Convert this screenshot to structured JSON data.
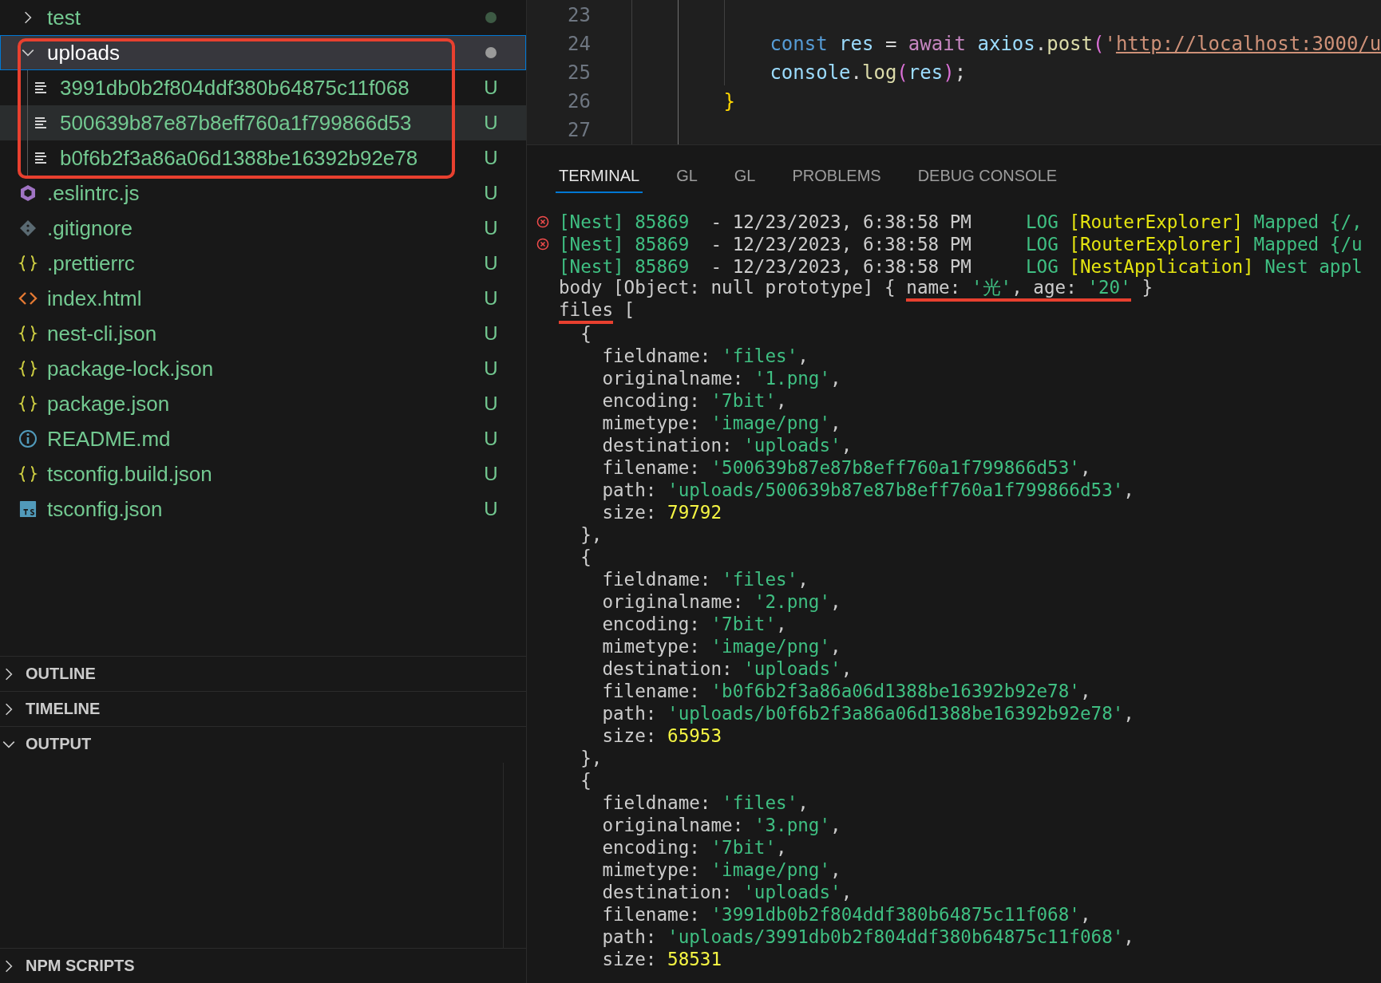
{
  "explorer": {
    "items": [
      {
        "name": "test",
        "kind": "folder",
        "expanded": false,
        "selected": false,
        "hovered": false,
        "dot": true
      },
      {
        "name": "uploads",
        "kind": "folder",
        "expanded": true,
        "selected": true,
        "hovered": false,
        "dot": true,
        "children": [
          {
            "name": "3991db0b2f804ddf380b64875c11f068",
            "kind": "text",
            "selected": false,
            "hovered": false,
            "badge": "U"
          },
          {
            "name": "500639b87e87b8eff760a1f799866d53",
            "kind": "text",
            "selected": false,
            "hovered": true,
            "badge": "U"
          },
          {
            "name": "b0f6b2f3a86a06d1388be16392b92e78",
            "kind": "text",
            "selected": false,
            "hovered": false,
            "badge": "U"
          }
        ]
      },
      {
        "name": ".eslintrc.js",
        "kind": "eslint",
        "selected": false,
        "hovered": false,
        "badge": "U"
      },
      {
        "name": ".gitignore",
        "kind": "git",
        "selected": false,
        "hovered": false,
        "badge": "U"
      },
      {
        "name": ".prettierrc",
        "kind": "braces",
        "selected": false,
        "hovered": false,
        "badge": "U"
      },
      {
        "name": "index.html",
        "kind": "code",
        "selected": false,
        "hovered": false,
        "badge": "U"
      },
      {
        "name": "nest-cli.json",
        "kind": "braces",
        "selected": false,
        "hovered": false,
        "badge": "U"
      },
      {
        "name": "package-lock.json",
        "kind": "braces",
        "selected": false,
        "hovered": false,
        "badge": "U"
      },
      {
        "name": "package.json",
        "kind": "braces",
        "selected": false,
        "hovered": false,
        "badge": "U"
      },
      {
        "name": "README.md",
        "kind": "info",
        "selected": false,
        "hovered": false,
        "badge": "U"
      },
      {
        "name": "tsconfig.build.json",
        "kind": "braces",
        "selected": false,
        "hovered": false,
        "badge": "U"
      },
      {
        "name": "tsconfig.json",
        "kind": "ts",
        "selected": false,
        "hovered": false,
        "badge": "U"
      }
    ]
  },
  "sections": [
    {
      "title": "OUTLINE",
      "expanded": false
    },
    {
      "title": "TIMELINE",
      "expanded": false
    },
    {
      "title": "OUTPUT",
      "expanded": true
    },
    {
      "title": "NPM SCRIPTS",
      "expanded": false
    }
  ],
  "editor": {
    "lines": [
      {
        "number": "23"
      },
      {
        "number": "24",
        "segments": [
          {
            "kind": "keyword",
            "text": "            const "
          },
          {
            "kind": "variable",
            "text": "res"
          },
          {
            "kind": "plain",
            "text": " = "
          },
          {
            "kind": "control",
            "text": "await "
          },
          {
            "kind": "variable",
            "text": "axios"
          },
          {
            "kind": "plain",
            "text": "."
          },
          {
            "kind": "function",
            "text": "post"
          },
          {
            "kind": "bracket",
            "text": "("
          },
          {
            "kind": "string",
            "text": "'"
          },
          {
            "kind": "link",
            "text": "http://localhost:3000/u"
          }
        ]
      },
      {
        "number": "25",
        "segments": [
          {
            "kind": "variable",
            "text": "            console"
          },
          {
            "kind": "plain",
            "text": "."
          },
          {
            "kind": "function",
            "text": "log"
          },
          {
            "kind": "bracket",
            "text": "("
          },
          {
            "kind": "variable",
            "text": "res"
          },
          {
            "kind": "bracket",
            "text": ")"
          },
          {
            "kind": "plain",
            "text": ";"
          }
        ]
      },
      {
        "number": "26",
        "segments": [
          {
            "kind": "brace",
            "text": "        }"
          }
        ]
      },
      {
        "number": "27"
      }
    ]
  },
  "panel": {
    "tabs": [
      {
        "label": "TERMINAL",
        "selected": true
      },
      {
        "label": "GL",
        "selected": false
      },
      {
        "label": "GL",
        "selected": false
      },
      {
        "label": "PROBLEMS",
        "selected": false
      },
      {
        "label": "DEBUG CONSOLE",
        "selected": false
      }
    ],
    "lines": [
      {
        "error": true,
        "segments": [
          {
            "kind": "tag",
            "text": "[Nest] 85869"
          },
          {
            "kind": "plain",
            "text": "  - 12/23/2023, 6:38:58 PM     "
          },
          {
            "kind": "tag",
            "text": "LOG "
          },
          {
            "kind": "context",
            "text": "[RouterExplorer]"
          },
          {
            "kind": "tag",
            "text": " Mapped {/,"
          }
        ]
      },
      {
        "error": true,
        "segments": [
          {
            "kind": "tag",
            "text": "[Nest] 85869"
          },
          {
            "kind": "plain",
            "text": "  - 12/23/2023, 6:38:58 PM     "
          },
          {
            "kind": "tag",
            "text": "LOG "
          },
          {
            "kind": "context",
            "text": "[RouterExplorer]"
          },
          {
            "kind": "tag",
            "text": " Mapped {/u"
          }
        ]
      },
      {
        "error": false,
        "segments": [
          {
            "kind": "tag",
            "text": "[Nest] 85869"
          },
          {
            "kind": "plain",
            "text": "  - 12/23/2023, 6:38:58 PM     "
          },
          {
            "kind": "tag",
            "text": "LOG "
          },
          {
            "kind": "context",
            "text": "[NestApplication]"
          },
          {
            "kind": "tag",
            "text": " Nest appl"
          }
        ]
      },
      {
        "error": false,
        "segments": [
          {
            "kind": "plain",
            "text": "body [Object: null prototype] { "
          },
          {
            "kind": "plain",
            "text": "name: ",
            "marked": true
          },
          {
            "kind": "string",
            "text": "'光'",
            "marked": true
          },
          {
            "kind": "plain",
            "text": ", age: ",
            "marked": true
          },
          {
            "kind": "string",
            "text": "'20'",
            "marked": true
          },
          {
            "kind": "plain",
            "text": " }"
          }
        ]
      },
      {
        "error": false,
        "segments": [
          {
            "kind": "plain",
            "text": "files",
            "marked": true
          },
          {
            "kind": "plain",
            "text": " ["
          }
        ]
      },
      {
        "error": false,
        "segments": [
          {
            "kind": "plain",
            "text": "  {"
          }
        ]
      },
      {
        "error": false,
        "segments": [
          {
            "kind": "plain",
            "text": "    fieldname: "
          },
          {
            "kind": "string",
            "text": "'files'"
          },
          {
            "kind": "plain",
            "text": ","
          }
        ]
      },
      {
        "error": false,
        "segments": [
          {
            "kind": "plain",
            "text": "    originalname: "
          },
          {
            "kind": "string",
            "text": "'1.png'"
          },
          {
            "kind": "plain",
            "text": ","
          }
        ]
      },
      {
        "error": false,
        "segments": [
          {
            "kind": "plain",
            "text": "    encoding: "
          },
          {
            "kind": "string",
            "text": "'7bit'"
          },
          {
            "kind": "plain",
            "text": ","
          }
        ]
      },
      {
        "error": false,
        "segments": [
          {
            "kind": "plain",
            "text": "    mimetype: "
          },
          {
            "kind": "string",
            "text": "'image/png'"
          },
          {
            "kind": "plain",
            "text": ","
          }
        ]
      },
      {
        "error": false,
        "segments": [
          {
            "kind": "plain",
            "text": "    destination: "
          },
          {
            "kind": "string",
            "text": "'uploads'"
          },
          {
            "kind": "plain",
            "text": ","
          }
        ]
      },
      {
        "error": false,
        "segments": [
          {
            "kind": "plain",
            "text": "    filename: "
          },
          {
            "kind": "string",
            "text": "'500639b87e87b8eff760a1f799866d53'"
          },
          {
            "kind": "plain",
            "text": ","
          }
        ]
      },
      {
        "error": false,
        "segments": [
          {
            "kind": "plain",
            "text": "    path: "
          },
          {
            "kind": "string",
            "text": "'uploads/500639b87e87b8eff760a1f799866d53'"
          },
          {
            "kind": "plain",
            "text": ","
          }
        ]
      },
      {
        "error": false,
        "segments": [
          {
            "kind": "plain",
            "text": "    size: "
          },
          {
            "kind": "number",
            "text": "79792"
          }
        ]
      },
      {
        "error": false,
        "segments": [
          {
            "kind": "plain",
            "text": "  },"
          }
        ]
      },
      {
        "error": false,
        "segments": [
          {
            "kind": "plain",
            "text": "  {"
          }
        ]
      },
      {
        "error": false,
        "segments": [
          {
            "kind": "plain",
            "text": "    fieldname: "
          },
          {
            "kind": "string",
            "text": "'files'"
          },
          {
            "kind": "plain",
            "text": ","
          }
        ]
      },
      {
        "error": false,
        "segments": [
          {
            "kind": "plain",
            "text": "    originalname: "
          },
          {
            "kind": "string",
            "text": "'2.png'"
          },
          {
            "kind": "plain",
            "text": ","
          }
        ]
      },
      {
        "error": false,
        "segments": [
          {
            "kind": "plain",
            "text": "    encoding: "
          },
          {
            "kind": "string",
            "text": "'7bit'"
          },
          {
            "kind": "plain",
            "text": ","
          }
        ]
      },
      {
        "error": false,
        "segments": [
          {
            "kind": "plain",
            "text": "    mimetype: "
          },
          {
            "kind": "string",
            "text": "'image/png'"
          },
          {
            "kind": "plain",
            "text": ","
          }
        ]
      },
      {
        "error": false,
        "segments": [
          {
            "kind": "plain",
            "text": "    destination: "
          },
          {
            "kind": "string",
            "text": "'uploads'"
          },
          {
            "kind": "plain",
            "text": ","
          }
        ]
      },
      {
        "error": false,
        "segments": [
          {
            "kind": "plain",
            "text": "    filename: "
          },
          {
            "kind": "string",
            "text": "'b0f6b2f3a86a06d1388be16392b92e78'"
          },
          {
            "kind": "plain",
            "text": ","
          }
        ]
      },
      {
        "error": false,
        "segments": [
          {
            "kind": "plain",
            "text": "    path: "
          },
          {
            "kind": "string",
            "text": "'uploads/b0f6b2f3a86a06d1388be16392b92e78'"
          },
          {
            "kind": "plain",
            "text": ","
          }
        ]
      },
      {
        "error": false,
        "segments": [
          {
            "kind": "plain",
            "text": "    size: "
          },
          {
            "kind": "number",
            "text": "65953"
          }
        ]
      },
      {
        "error": false,
        "segments": [
          {
            "kind": "plain",
            "text": "  },"
          }
        ]
      },
      {
        "error": false,
        "segments": [
          {
            "kind": "plain",
            "text": "  {"
          }
        ]
      },
      {
        "error": false,
        "segments": [
          {
            "kind": "plain",
            "text": "    fieldname: "
          },
          {
            "kind": "string",
            "text": "'files'"
          },
          {
            "kind": "plain",
            "text": ","
          }
        ]
      },
      {
        "error": false,
        "segments": [
          {
            "kind": "plain",
            "text": "    originalname: "
          },
          {
            "kind": "string",
            "text": "'3.png'"
          },
          {
            "kind": "plain",
            "text": ","
          }
        ]
      },
      {
        "error": false,
        "segments": [
          {
            "kind": "plain",
            "text": "    encoding: "
          },
          {
            "kind": "string",
            "text": "'7bit'"
          },
          {
            "kind": "plain",
            "text": ","
          }
        ]
      },
      {
        "error": false,
        "segments": [
          {
            "kind": "plain",
            "text": "    mimetype: "
          },
          {
            "kind": "string",
            "text": "'image/png'"
          },
          {
            "kind": "plain",
            "text": ","
          }
        ]
      },
      {
        "error": false,
        "segments": [
          {
            "kind": "plain",
            "text": "    destination: "
          },
          {
            "kind": "string",
            "text": "'uploads'"
          },
          {
            "kind": "plain",
            "text": ","
          }
        ]
      },
      {
        "error": false,
        "segments": [
          {
            "kind": "plain",
            "text": "    filename: "
          },
          {
            "kind": "string",
            "text": "'3991db0b2f804ddf380b64875c11f068'"
          },
          {
            "kind": "plain",
            "text": ","
          }
        ]
      },
      {
        "error": false,
        "segments": [
          {
            "kind": "plain",
            "text": "    path: "
          },
          {
            "kind": "string",
            "text": "'uploads/3991db0b2f804ddf380b64875c11f068'"
          },
          {
            "kind": "plain",
            "text": ","
          }
        ]
      },
      {
        "error": false,
        "segments": [
          {
            "kind": "plain",
            "text": "    size: "
          },
          {
            "kind": "number",
            "text": "58531"
          }
        ]
      }
    ]
  }
}
